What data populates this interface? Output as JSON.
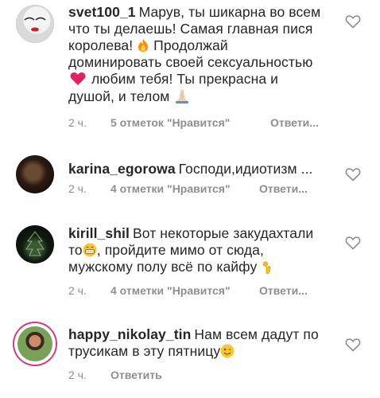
{
  "comments": [
    {
      "username": "svet100_1",
      "parts": [
        "Марув, ты шикарна во всем что ты делаешь! Самая главная пися королева!",
        "Продолжай доминировать своей сексуальностью",
        "любим тебя! Ты прекрасна и душой, и телом"
      ],
      "emoji": [
        "fire",
        "red-heart",
        "folded-hands"
      ],
      "time": "2 ч.",
      "likes": "5 отметок \"Нравится\"",
      "reply": "Ответи..."
    },
    {
      "username": "karina_egorowa",
      "parts": [
        "Господи,идиотизм ..."
      ],
      "emoji": [],
      "time": "2 ч.",
      "likes": "4 отметки \"Нравится\"",
      "reply": "Ответи..."
    },
    {
      "username": "kirill_shil",
      "parts": [
        "Вот некоторые закудахтали то",
        ", пройдите мимо от сюда, мужскому полу всё по кайфу"
      ],
      "emoji": [
        "grinning-face",
        "ok-hand"
      ],
      "time": "2 ч.",
      "likes": "4 отметки \"Нравится\"",
      "reply": "Ответи..."
    },
    {
      "username": "happy_nikolay_tin",
      "parts": [
        "Нам всем дадут по трусикам в эту пятницу"
      ],
      "emoji": [
        "winking-face"
      ],
      "time": "2 ч.",
      "reply": "Ответить"
    }
  ],
  "colors": {
    "text": "#262626",
    "meta": "#8e8e8e",
    "heart_outline": "#8e8e8e",
    "story_ring": "#d23b7a",
    "emoji_heart": "#e0245e",
    "emoji_yellow": "#f7c634"
  }
}
